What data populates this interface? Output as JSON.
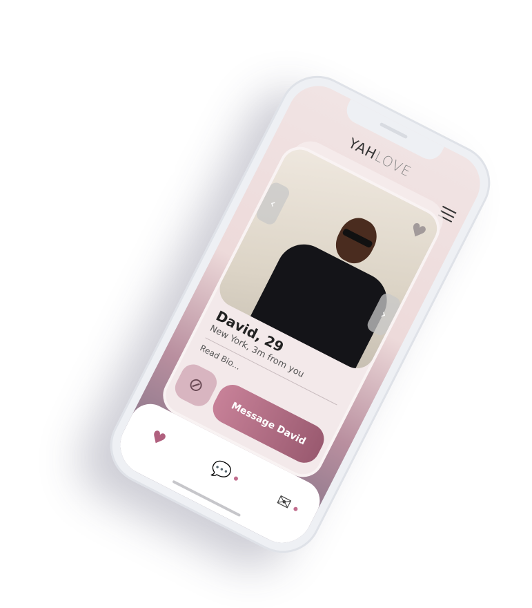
{
  "app": {
    "logo_bold": "YAH",
    "logo_light": "LOVE"
  },
  "profile": {
    "name_age": "David, 29",
    "location": "New York, 3m from you",
    "bio_link": "Read Bio..."
  },
  "actions": {
    "message_label": "Message David"
  },
  "icons": {
    "prev": "‹",
    "next": "›",
    "favorite": "♥",
    "block": "⊘",
    "likes": "♥",
    "chats": "💬",
    "mail": "✉"
  },
  "colors": {
    "accent": "#b0607e",
    "button": "#c78198"
  }
}
